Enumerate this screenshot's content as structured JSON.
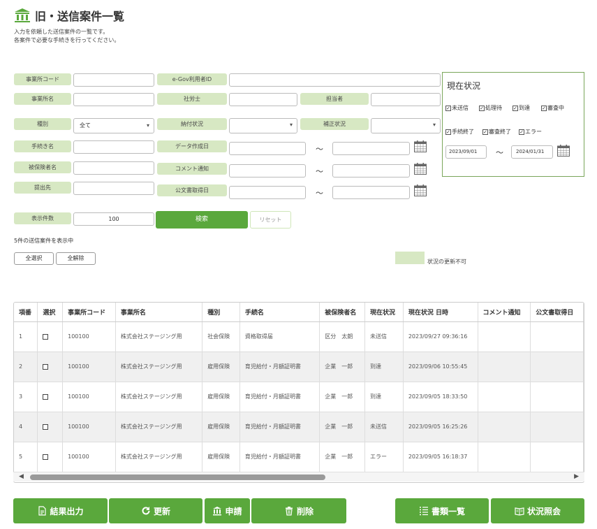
{
  "header": {
    "title": "旧・送信案件一覧",
    "desc1": "入力を依頼した送信案件の一覧です。",
    "desc2": "各案件で必要な手続きを行ってください。"
  },
  "form": {
    "office_code_label": "事業所コード",
    "egov_label": "e-Gov利用者ID",
    "office_name_label": "事業所名",
    "sharoushi_label": "社労士",
    "tantou_label": "担当者",
    "type_label": "種別",
    "type_value": "全て",
    "nofu_label": "納付状況",
    "hosei_label": "補正状況",
    "procedure_label": "手続き名",
    "data_created_label": "データ作成日",
    "insured_label": "被保険者名",
    "comment_label": "コメント通知",
    "submit_to_label": "提出先",
    "official_doc_label": "公文書取得日",
    "display_count_label": "表示件数",
    "display_count_value": "100",
    "tilde": "～"
  },
  "buttons": {
    "search": "検索",
    "reset": "リセット",
    "select_all": "全選択",
    "deselect_all": "全解除"
  },
  "status_panel": {
    "title": "現在状況",
    "checks": [
      "未送信",
      "処理待",
      "到達",
      "審査中",
      "手続終了",
      "審査終了",
      "エラー"
    ],
    "date_from": "2023/09/01",
    "date_to": "2024/01/31"
  },
  "result_count": "5件の送信案件を表示中",
  "legend_text": "状況の更新不可",
  "table": {
    "headers": [
      "項番",
      "選択",
      "事業所コード",
      "事業所名",
      "種別",
      "手続名",
      "被保険者名",
      "現在状況",
      "現在状況 日時",
      "コメント通知",
      "公文書取得日"
    ],
    "rows": [
      {
        "no": "1",
        "code": "100100",
        "office": "株式会社ステージング用",
        "type": "社会保険",
        "proc": "資格取得届",
        "insured": "区分　太朗",
        "status": "未送信",
        "datetime": "2023/09/27 09:36:16"
      },
      {
        "no": "2",
        "code": "100100",
        "office": "株式会社ステージング用",
        "type": "雇用保険",
        "proc": "育児給付・月額証明書",
        "insured": "企業　一郎",
        "status": "到達",
        "datetime": "2023/09/06 10:55:45"
      },
      {
        "no": "3",
        "code": "100100",
        "office": "株式会社ステージング用",
        "type": "雇用保険",
        "proc": "育児給付・月額証明書",
        "insured": "企業　一郎",
        "status": "到達",
        "datetime": "2023/09/05 18:33:50"
      },
      {
        "no": "4",
        "code": "100100",
        "office": "株式会社ステージング用",
        "type": "雇用保険",
        "proc": "育児給付・月額証明書",
        "insured": "企業　一郎",
        "status": "未送信",
        "datetime": "2023/09/05 16:25:26"
      },
      {
        "no": "5",
        "code": "100100",
        "office": "株式会社ステージング用",
        "type": "雇用保険",
        "proc": "育児給付・月額証明書",
        "insured": "企業　一郎",
        "status": "エラー",
        "datetime": "2023/09/05 16:18:37"
      }
    ]
  },
  "bottom_buttons": {
    "export": "結果出力",
    "refresh": "更新",
    "apply": "申請",
    "delete": "削除",
    "docs": "書類一覧",
    "status_inquiry": "状況照会"
  },
  "colors": {
    "accent": "#5aa83c",
    "label_bg": "#d7e8c3"
  }
}
